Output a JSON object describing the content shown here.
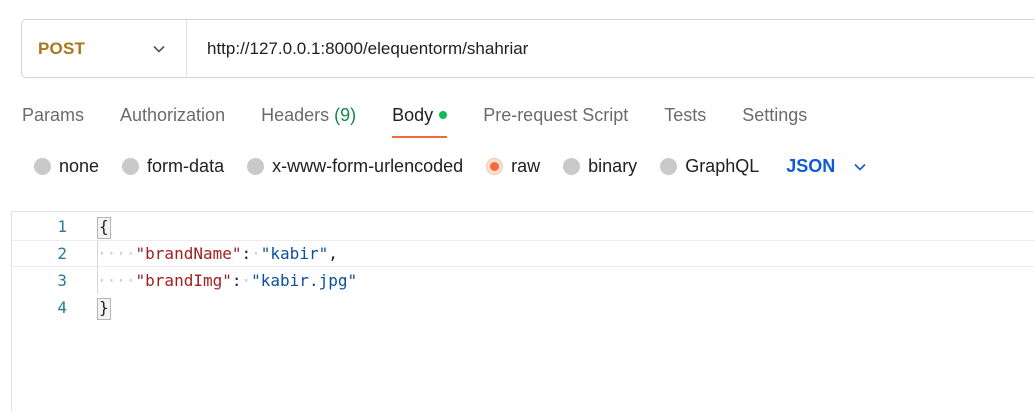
{
  "request": {
    "method": "POST",
    "url": "http://127.0.0.1:8000/elequentorm/shahriar"
  },
  "tabs": [
    {
      "label": "Params"
    },
    {
      "label": "Authorization"
    },
    {
      "label": "Headers",
      "count": "(9)"
    },
    {
      "label": "Body"
    },
    {
      "label": "Pre-request Script"
    },
    {
      "label": "Tests"
    },
    {
      "label": "Settings"
    }
  ],
  "body_types": [
    {
      "label": "none",
      "checked": false
    },
    {
      "label": "form-data",
      "checked": false
    },
    {
      "label": "x-www-form-urlencoded",
      "checked": false
    },
    {
      "label": "raw",
      "checked": true
    },
    {
      "label": "binary",
      "checked": false
    },
    {
      "label": "GraphQL",
      "checked": false
    }
  ],
  "language": "JSON",
  "editor": {
    "lines": [
      {
        "number": "1",
        "open_brace": "{"
      },
      {
        "number": "2",
        "key": "\"brandName\"",
        "colon": ":",
        "value": "\"kabir\"",
        "trail": ","
      },
      {
        "number": "3",
        "key": "\"brandImg\"",
        "colon": ":",
        "value": "\"kabir.jpg\"",
        "trail": ""
      },
      {
        "number": "4",
        "close_brace": "}"
      }
    ],
    "indent_marker": "····"
  },
  "colors": {
    "method": "#a8761c",
    "active_tab_underline": "#f26b3a",
    "body_dot": "#0cbb52",
    "language": "#0e5bd8",
    "json_key": "#a11f1f",
    "json_string": "#0b4f9c"
  },
  "icons": [
    "chevron-down-icon"
  ]
}
